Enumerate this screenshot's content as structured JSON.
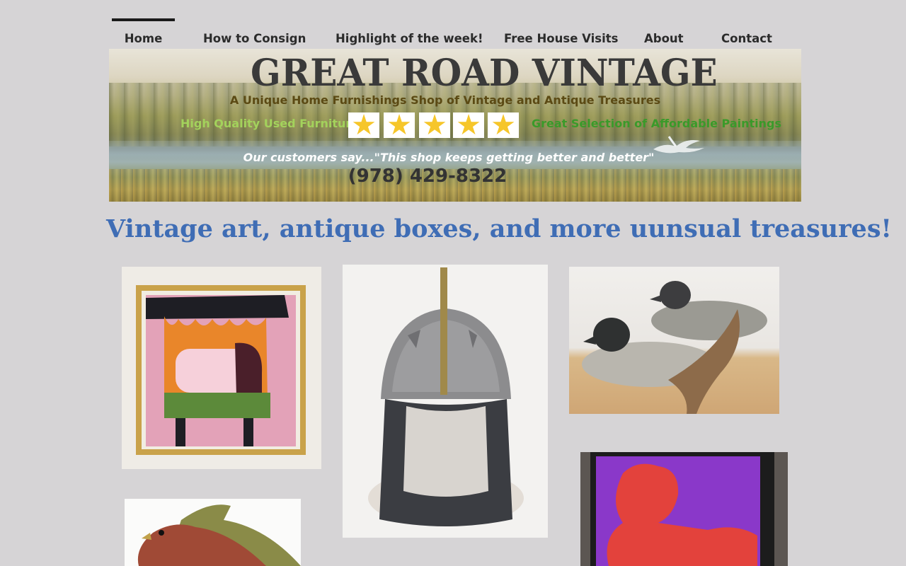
{
  "nav": {
    "items": [
      {
        "label": "Home",
        "active": true
      },
      {
        "label": "How to Consign",
        "active": false
      },
      {
        "label": "Highlight of the week!",
        "active": false
      },
      {
        "label": "Free House Visits",
        "active": false
      },
      {
        "label": "About",
        "active": false
      },
      {
        "label": "Contact",
        "active": false
      }
    ]
  },
  "banner": {
    "title": "GREAT ROAD VINTAGE",
    "tagline": "A Unique Home Furnishings Shop of Vintage and Antique Treasures",
    "feature_left": "High Quality Used Furniture",
    "feature_right": "Great Selection of Affordable Paintings",
    "rating_stars": 5,
    "quote": "Our customers say...\"This shop keeps getting better and better\"",
    "phone": "(978) 429-8322"
  },
  "main": {
    "headline": "Vintage art, antique boxes, and more uunsual treasures!"
  },
  "colors": {
    "page_bg": "#d6d4d6",
    "headline": "#3f6db5",
    "star": "#f6c62a",
    "feature_left": "#a3d25c",
    "feature_right": "#3a9a2a",
    "tagline": "#5b4a14"
  }
}
